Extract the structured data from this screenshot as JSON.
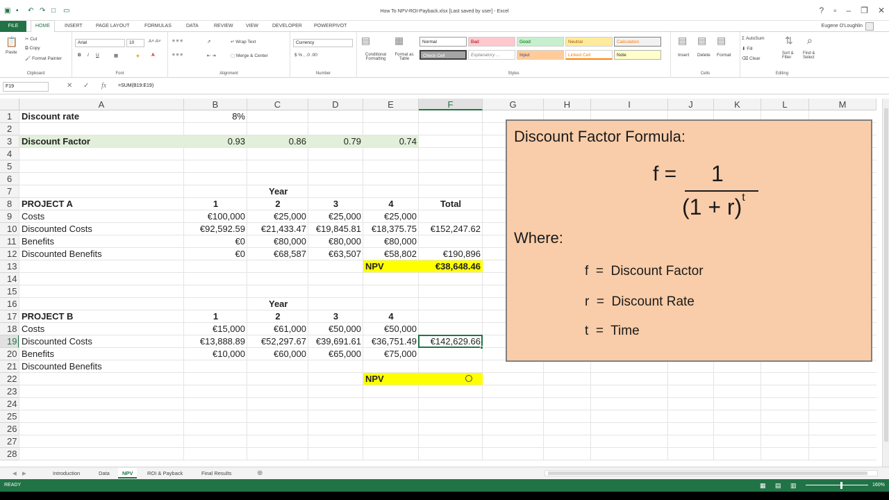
{
  "window": {
    "title": "How To NPV-ROI-Payback.xlsx [Last saved by user] - Excel",
    "user": "Eugene O'Loughlin"
  },
  "ribbon_tabs": [
    "HOME",
    "INSERT",
    "PAGE LAYOUT",
    "FORMULAS",
    "DATA",
    "REVIEW",
    "VIEW",
    "DEVELOPER",
    "POWERPIVOT"
  ],
  "file_tab": "FILE",
  "ribbon": {
    "clipboard": {
      "paste": "Paste",
      "cut": "Cut",
      "copy": "Copy",
      "format_painter": "Format Painter",
      "label": "Clipboard"
    },
    "font": {
      "name": "Arial",
      "size": "10",
      "label": "Font"
    },
    "alignment": {
      "wrap": "Wrap Text",
      "merge": "Merge & Center",
      "label": "Alignment"
    },
    "number": {
      "format": "Currency",
      "label": "Number"
    },
    "styles": {
      "conditional": "Conditional Formatting",
      "format_table": "Format as Table",
      "normal": "Normal",
      "bad": "Bad",
      "good": "Good",
      "neutral": "Neutral",
      "calculation": "Calculation",
      "check_cell": "Check Cell",
      "explanatory": "Explanatory ...",
      "input": "Input",
      "linked_cell": "Linked Cell",
      "note": "Note",
      "label": "Styles"
    },
    "cells": {
      "insert": "Insert",
      "delete": "Delete",
      "format": "Format",
      "label": "Cells"
    },
    "editing": {
      "autosum": "AutoSum",
      "fill": "Fill",
      "clear": "Clear",
      "sort": "Sort & Filter",
      "find": "Find & Select",
      "label": "Editing"
    }
  },
  "formula_bar": {
    "name_box": "F19",
    "formula": "=SUM(B19:E19)"
  },
  "columns": [
    "A",
    "B",
    "C",
    "D",
    "E",
    "F",
    "G",
    "H",
    "I",
    "J",
    "K",
    "L",
    "M"
  ],
  "rows": [
    "1",
    "2",
    "3",
    "4",
    "5",
    "6",
    "7",
    "8",
    "9",
    "10",
    "11",
    "12",
    "13",
    "14",
    "15",
    "16",
    "17",
    "18",
    "19",
    "20",
    "21",
    "22",
    "23",
    "24",
    "25",
    "26",
    "27",
    "28"
  ],
  "cells": {
    "A1": "Discount rate",
    "B1": "8%",
    "A3": "Discount Factor",
    "B3": "0.93",
    "C3": "0.86",
    "D3": "0.79",
    "E3": "0.74",
    "D7": "Year",
    "A8": "PROJECT A",
    "B8": "1",
    "C8": "2",
    "D8": "3",
    "E8": "4",
    "F8": "Total",
    "A9": "Costs",
    "B9": "€100,000",
    "C9": "€25,000",
    "D9": "€25,000",
    "E9": "€25,000",
    "A10": "Discounted Costs",
    "B10": "€92,592.59",
    "C10": "€21,433.47",
    "D10": "€19,845.81",
    "E10": "€18,375.75",
    "F10": "€152,247.62",
    "A11": "Benefits",
    "B11": "€0",
    "C11": "€80,000",
    "D11": "€80,000",
    "E11": "€80,000",
    "A12": "Discounted Benefits",
    "B12": "€0",
    "C12": "€68,587",
    "D12": "€63,507",
    "E12": "€58,802",
    "F12": "€190,896",
    "E13": "NPV",
    "F13": "€38,648.46",
    "D16": "Year",
    "A17": "PROJECT B",
    "B17": "1",
    "C17": "2",
    "D17": "3",
    "E17": "4",
    "A18": "Costs",
    "B18": "€15,000",
    "C18": "€61,000",
    "D18": "€50,000",
    "E18": "€50,000",
    "A19": "Discounted Costs",
    "B19": "€13,888.89",
    "C19": "€52,297.67",
    "D19": "€39,691.61",
    "E19": "€36,751.49",
    "F19": "€142,629.66",
    "A20": "Benefits",
    "B20": "€10,000",
    "C20": "€60,000",
    "D20": "€65,000",
    "E20": "€75,000",
    "A21": "Discounted Benefits",
    "E22": "NPV"
  },
  "formula_box": {
    "title": "Discount Factor Formula:",
    "f_eq": "f =",
    "numerator": "1",
    "denominator": "(1  + r)",
    "exponent": "t",
    "where": "Where:",
    "defs": [
      "f  =  Discount Factor",
      "r  =  Discount Rate",
      "t  =  Time"
    ]
  },
  "sheet_tabs": [
    "Introduction",
    "Data",
    "NPV",
    "ROI & Payback",
    "Final Results"
  ],
  "active_sheet": "NPV",
  "status": {
    "left": "READY",
    "zoom": "160%"
  },
  "colors": {
    "excel_green": "#217346",
    "highlight_green": "#e2efda",
    "npv_yellow": "#ffff00",
    "formula_box": "#f9cda9"
  }
}
